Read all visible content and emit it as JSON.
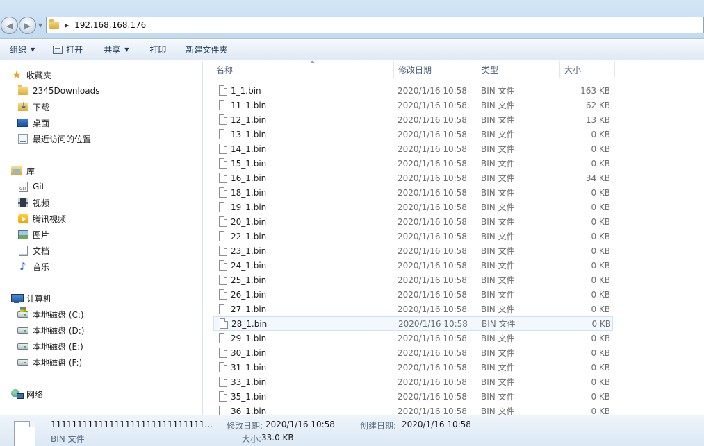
{
  "address": {
    "path": "192.168.168.176"
  },
  "toolbar": {
    "organize": "组织",
    "open": "打开",
    "share": "共享",
    "print": "打印",
    "new_folder": "新建文件夹"
  },
  "sidebar": {
    "favorites": {
      "label": "收藏夹",
      "items": [
        {
          "label": "2345Downloads",
          "icon": "folder-icon"
        },
        {
          "label": "下载",
          "icon": "downloads-icon"
        },
        {
          "label": "桌面",
          "icon": "desktop-icon"
        },
        {
          "label": "最近访问的位置",
          "icon": "recent-places-icon"
        }
      ]
    },
    "libraries": {
      "label": "库",
      "items": [
        {
          "label": "Git",
          "icon": "git-icon"
        },
        {
          "label": "视频",
          "icon": "video-icon"
        },
        {
          "label": "腾讯视频",
          "icon": "tencent-video-icon"
        },
        {
          "label": "图片",
          "icon": "pictures-icon"
        },
        {
          "label": "文档",
          "icon": "documents-icon"
        },
        {
          "label": "音乐",
          "icon": "music-icon"
        }
      ]
    },
    "computer": {
      "label": "计算机",
      "items": [
        {
          "label": "本地磁盘 (C:)",
          "icon": "system-drive-icon"
        },
        {
          "label": "本地磁盘 (D:)",
          "icon": "drive-icon"
        },
        {
          "label": "本地磁盘 (E:)",
          "icon": "drive-icon"
        },
        {
          "label": "本地磁盘 (F:)",
          "icon": "drive-icon"
        }
      ]
    },
    "network": {
      "label": "网络"
    }
  },
  "columns": {
    "name": "名称",
    "date": "修改日期",
    "type": "类型",
    "size": "大小"
  },
  "files": [
    {
      "name": "1_1.bin",
      "date": "2020/1/16 10:58",
      "type": "BIN 文件",
      "size": "163 KB"
    },
    {
      "name": "11_1.bin",
      "date": "2020/1/16 10:58",
      "type": "BIN 文件",
      "size": "62 KB"
    },
    {
      "name": "12_1.bin",
      "date": "2020/1/16 10:58",
      "type": "BIN 文件",
      "size": "13 KB"
    },
    {
      "name": "13_1.bin",
      "date": "2020/1/16 10:58",
      "type": "BIN 文件",
      "size": "0 KB"
    },
    {
      "name": "14_1.bin",
      "date": "2020/1/16 10:58",
      "type": "BIN 文件",
      "size": "0 KB"
    },
    {
      "name": "15_1.bin",
      "date": "2020/1/16 10:58",
      "type": "BIN 文件",
      "size": "0 KB"
    },
    {
      "name": "16_1.bin",
      "date": "2020/1/16 10:58",
      "type": "BIN 文件",
      "size": "34 KB"
    },
    {
      "name": "18_1.bin",
      "date": "2020/1/16 10:58",
      "type": "BIN 文件",
      "size": "0 KB"
    },
    {
      "name": "19_1.bin",
      "date": "2020/1/16 10:58",
      "type": "BIN 文件",
      "size": "0 KB"
    },
    {
      "name": "20_1.bin",
      "date": "2020/1/16 10:58",
      "type": "BIN 文件",
      "size": "0 KB"
    },
    {
      "name": "22_1.bin",
      "date": "2020/1/16 10:58",
      "type": "BIN 文件",
      "size": "0 KB"
    },
    {
      "name": "23_1.bin",
      "date": "2020/1/16 10:58",
      "type": "BIN 文件",
      "size": "0 KB"
    },
    {
      "name": "24_1.bin",
      "date": "2020/1/16 10:58",
      "type": "BIN 文件",
      "size": "0 KB"
    },
    {
      "name": "25_1.bin",
      "date": "2020/1/16 10:58",
      "type": "BIN 文件",
      "size": "0 KB"
    },
    {
      "name": "26_1.bin",
      "date": "2020/1/16 10:58",
      "type": "BIN 文件",
      "size": "0 KB"
    },
    {
      "name": "27_1.bin",
      "date": "2020/1/16 10:58",
      "type": "BIN 文件",
      "size": "0 KB"
    },
    {
      "name": "28_1.bin",
      "date": "2020/1/16 10:58",
      "type": "BIN 文件",
      "size": "0 KB",
      "hovered": true
    },
    {
      "name": "29_1.bin",
      "date": "2020/1/16 10:58",
      "type": "BIN 文件",
      "size": "0 KB"
    },
    {
      "name": "30_1.bin",
      "date": "2020/1/16 10:58",
      "type": "BIN 文件",
      "size": "0 KB"
    },
    {
      "name": "31_1.bin",
      "date": "2020/1/16 10:58",
      "type": "BIN 文件",
      "size": "0 KB"
    },
    {
      "name": "33_1.bin",
      "date": "2020/1/16 10:58",
      "type": "BIN 文件",
      "size": "0 KB"
    },
    {
      "name": "35_1.bin",
      "date": "2020/1/16 10:58",
      "type": "BIN 文件",
      "size": "0 KB"
    },
    {
      "name": "36_1.bin",
      "date": "2020/1/16 10:58",
      "type": "BIN 文件",
      "size": "0 KB"
    }
  ],
  "details": {
    "name": "11111111111111111111111111111...",
    "type": "BIN 文件",
    "modified_label": "修改日期:",
    "modified_value": "2020/1/16 10:58",
    "size_label": "大小:",
    "size_value": "33.0 KB",
    "created_label": "创建日期:",
    "created_value": "2020/1/16 10:58"
  },
  "colors": {
    "selection_bg": "#f2f8fe",
    "selection_border": "#cde3f9",
    "toolbar_text": "#1e395b"
  }
}
